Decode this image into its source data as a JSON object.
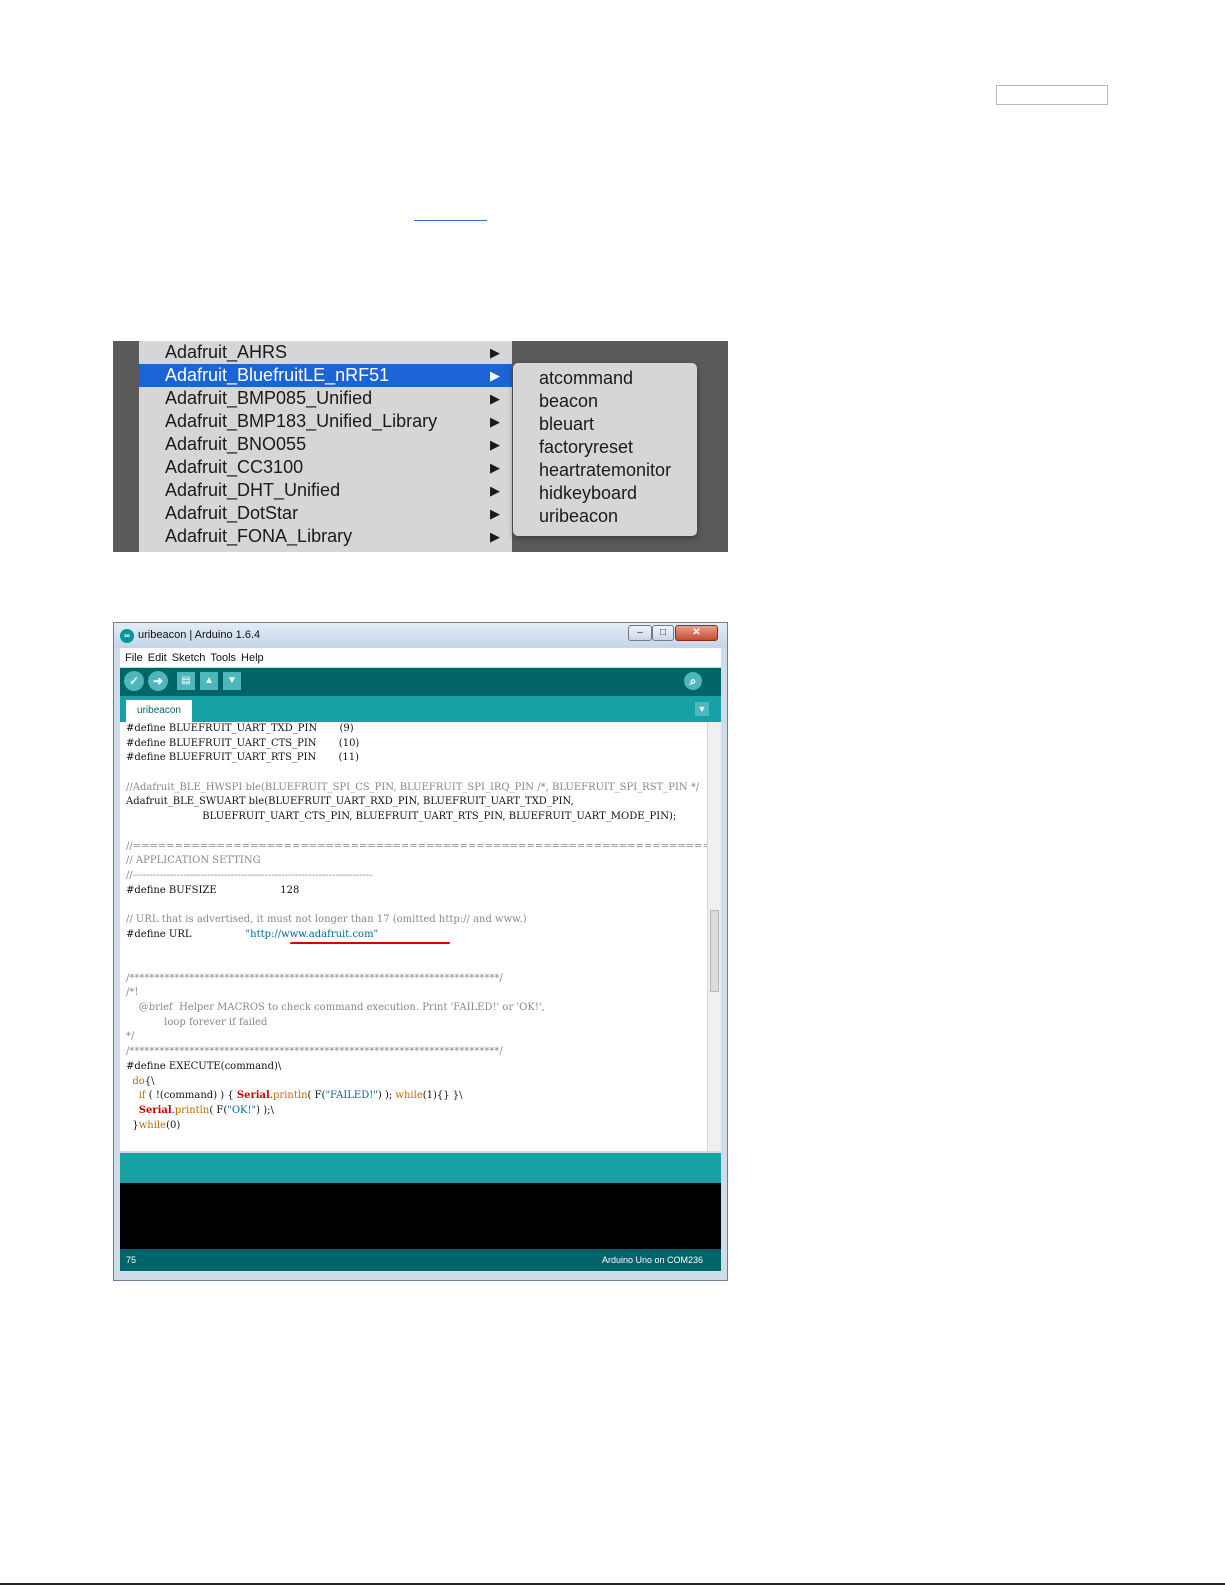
{
  "menu": {
    "items": [
      {
        "label": "Adafruit_AHRS",
        "selected": false
      },
      {
        "label": "Adafruit_BluefruitLE_nRF51",
        "selected": true
      },
      {
        "label": "Adafruit_BMP085_Unified",
        "selected": false
      },
      {
        "label": "Adafruit_BMP183_Unified_Library",
        "selected": false
      },
      {
        "label": "Adafruit_BNO055",
        "selected": false
      },
      {
        "label": "Adafruit_CC3100",
        "selected": false
      },
      {
        "label": "Adafruit_DHT_Unified",
        "selected": false
      },
      {
        "label": "Adafruit_DotStar",
        "selected": false
      },
      {
        "label": "Adafruit_FONA_Library",
        "selected": false
      }
    ],
    "arrow": "▶",
    "submenu": [
      "atcommand",
      "beacon",
      "bleuart",
      "factoryreset",
      "heartratemonitor",
      "hidkeyboard",
      "uribeacon"
    ]
  },
  "arduino": {
    "title": "uribeacon | Arduino 1.6.4",
    "menubar": [
      "File",
      "Edit",
      "Sketch",
      "Tools",
      "Help"
    ],
    "tab": "uribeacon",
    "code": {
      "l1": "#define BLUEFRUIT_UART_TXD_PIN       (9)",
      "l2": "#define BLUEFRUIT_UART_CTS_PIN       (10)",
      "l3": "#define BLUEFRUIT_UART_RTS_PIN       (11)",
      "l4": "",
      "l5": "//Adafruit_BLE_HWSPI ble(BLUEFRUIT_SPI_CS_PIN, BLUEFRUIT_SPI_IRQ_PIN /*, BLUEFRUIT_SPI_RST_PIN */",
      "l6": "Adafruit_BLE_SWUART ble(BLUEFRUIT_UART_RXD_PIN, BLUEFRUIT_UART_TXD_PIN,",
      "l7": "                        BLUEFRUIT_UART_CTS_PIN, BLUEFRUIT_UART_RTS_PIN, BLUEFRUIT_UART_MODE_PIN);",
      "l8": "",
      "l9": "//=======================================================================",
      "l10": "// APPLICATION SETTING",
      "l11": "//-----------------------------------------------------------------------",
      "l12": "#define BUFSIZE                    128",
      "l13": "",
      "l14": "// URL that is advertised, it must not longer than 17 (omitted http:// and www.)",
      "l15a": "#define URL                 ",
      "l15b": "\"http://www.adafruit.com\"",
      "l16": "",
      "l17": "",
      "l18": "/**************************************************************************/",
      "l19": "/*!",
      "l20": "    @brief  Helper MACROS to check command execution. Print 'FAILED!' or 'OK!',",
      "l21": "            loop forever if failed",
      "l22": "*/",
      "l23": "/**************************************************************************/",
      "l24": "#define EXECUTE(command)\\",
      "l25a": "  ",
      "l25b": "do",
      "l25c": "{\\",
      "l26a": "    ",
      "l26b": "if",
      "l26c": " ( !(command) ) { ",
      "l26d": "Serial",
      "l26e": ".",
      "l26f": "println",
      "l26g": "( F(",
      "l26h": "\"FAILED!\"",
      "l26i": ") ); ",
      "l26j": "while",
      "l26k": "(1){} }\\",
      "l27a": "    ",
      "l27b": "Serial",
      "l27c": ".",
      "l27d": "println",
      "l27e": "( F(",
      "l27f": "\"OK!\"",
      "l27g": ") );\\",
      "l28a": "  }",
      "l28b": "while",
      "l28c": "(0)"
    },
    "status_line": "75",
    "board": "Arduino Uno on COM236"
  }
}
